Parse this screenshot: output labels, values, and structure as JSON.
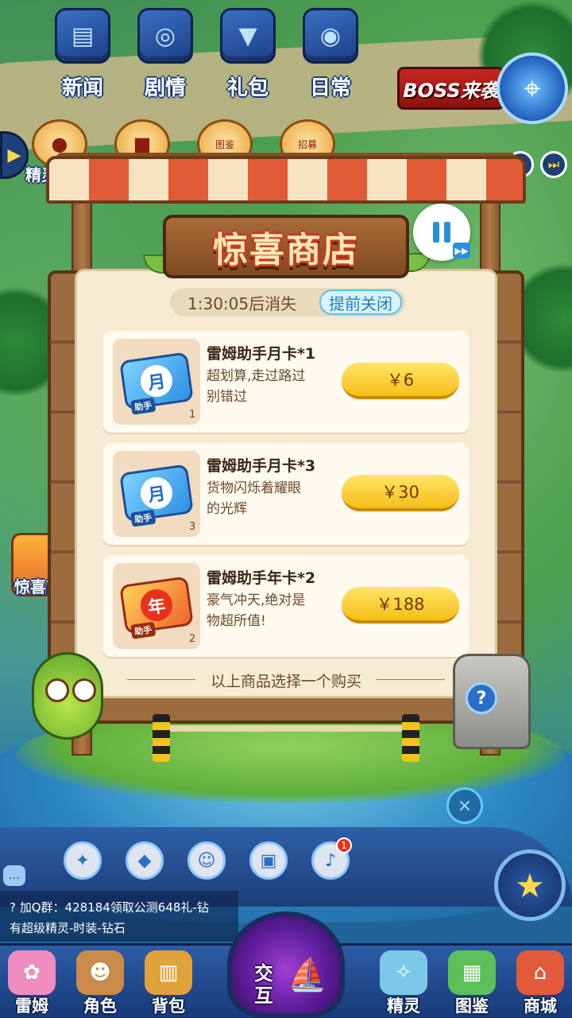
{
  "top_menu": [
    {
      "label": "新闻",
      "icon": "newspaper-icon"
    },
    {
      "label": "剧情",
      "icon": "story-icon"
    },
    {
      "label": "礼包",
      "icon": "gift-icon"
    },
    {
      "label": "日常",
      "icon": "daily-icon"
    }
  ],
  "boss_banner": "BOSS来袭",
  "secondary_labels": [
    "图鉴",
    "招募"
  ],
  "left_side_label": "精灵",
  "left_shop_label": "惊喜商店",
  "shop": {
    "title": "惊喜商店",
    "timer": "1:30:05后消失",
    "close_early": "提前关闭",
    "items": [
      {
        "name": "雷姆助手月卡*1",
        "desc": "超划算,走过路过别错过",
        "price": "￥6",
        "qty": "1",
        "card_glyph": "月",
        "card_tag": "助手",
        "card_color": "blue"
      },
      {
        "name": "雷姆助手月卡*3",
        "desc": "货物闪烁着耀眼的光辉",
        "price": "￥30",
        "qty": "3",
        "card_glyph": "月",
        "card_tag": "助手",
        "card_color": "blue"
      },
      {
        "name": "雷姆助手年卡*2",
        "desc": "豪气冲天,绝对是物超所值!",
        "price": "￥188",
        "qty": "2",
        "card_glyph": "年",
        "card_tag": "助手",
        "card_color": "red"
      }
    ],
    "footer": "以上商品选择一个购买"
  },
  "help_symbol": "?",
  "close_symbol": "×",
  "quick_buttons": [
    {
      "icon": "compass-icon",
      "badge": null
    },
    {
      "icon": "treasure-icon",
      "badge": null
    },
    {
      "icon": "pet-face-icon",
      "badge": null
    },
    {
      "icon": "bag-icon",
      "badge": null
    },
    {
      "icon": "bell-icon",
      "badge": "1"
    }
  ],
  "chat": [
    "? 加Q群：428184领取公测648礼-钻",
    "有超级精灵-时装-钻石"
  ],
  "bottom_nav": [
    {
      "label": "雷姆",
      "icon": "pink-pet-icon"
    },
    {
      "label": "角色",
      "icon": "character-icon"
    },
    {
      "label": "背包",
      "icon": "backpack-icon"
    },
    {
      "label": "精灵",
      "icon": "spirit-icon"
    },
    {
      "label": "图鉴",
      "icon": "handbook-icon"
    },
    {
      "label": "商城",
      "icon": "store-icon"
    }
  ],
  "center_button": "交互",
  "colors": {
    "accent_blue": "#2a8fe0",
    "price_yellow": "#f6bf18",
    "wood": "#9c6c3e",
    "title_red": "#c23d1e"
  }
}
